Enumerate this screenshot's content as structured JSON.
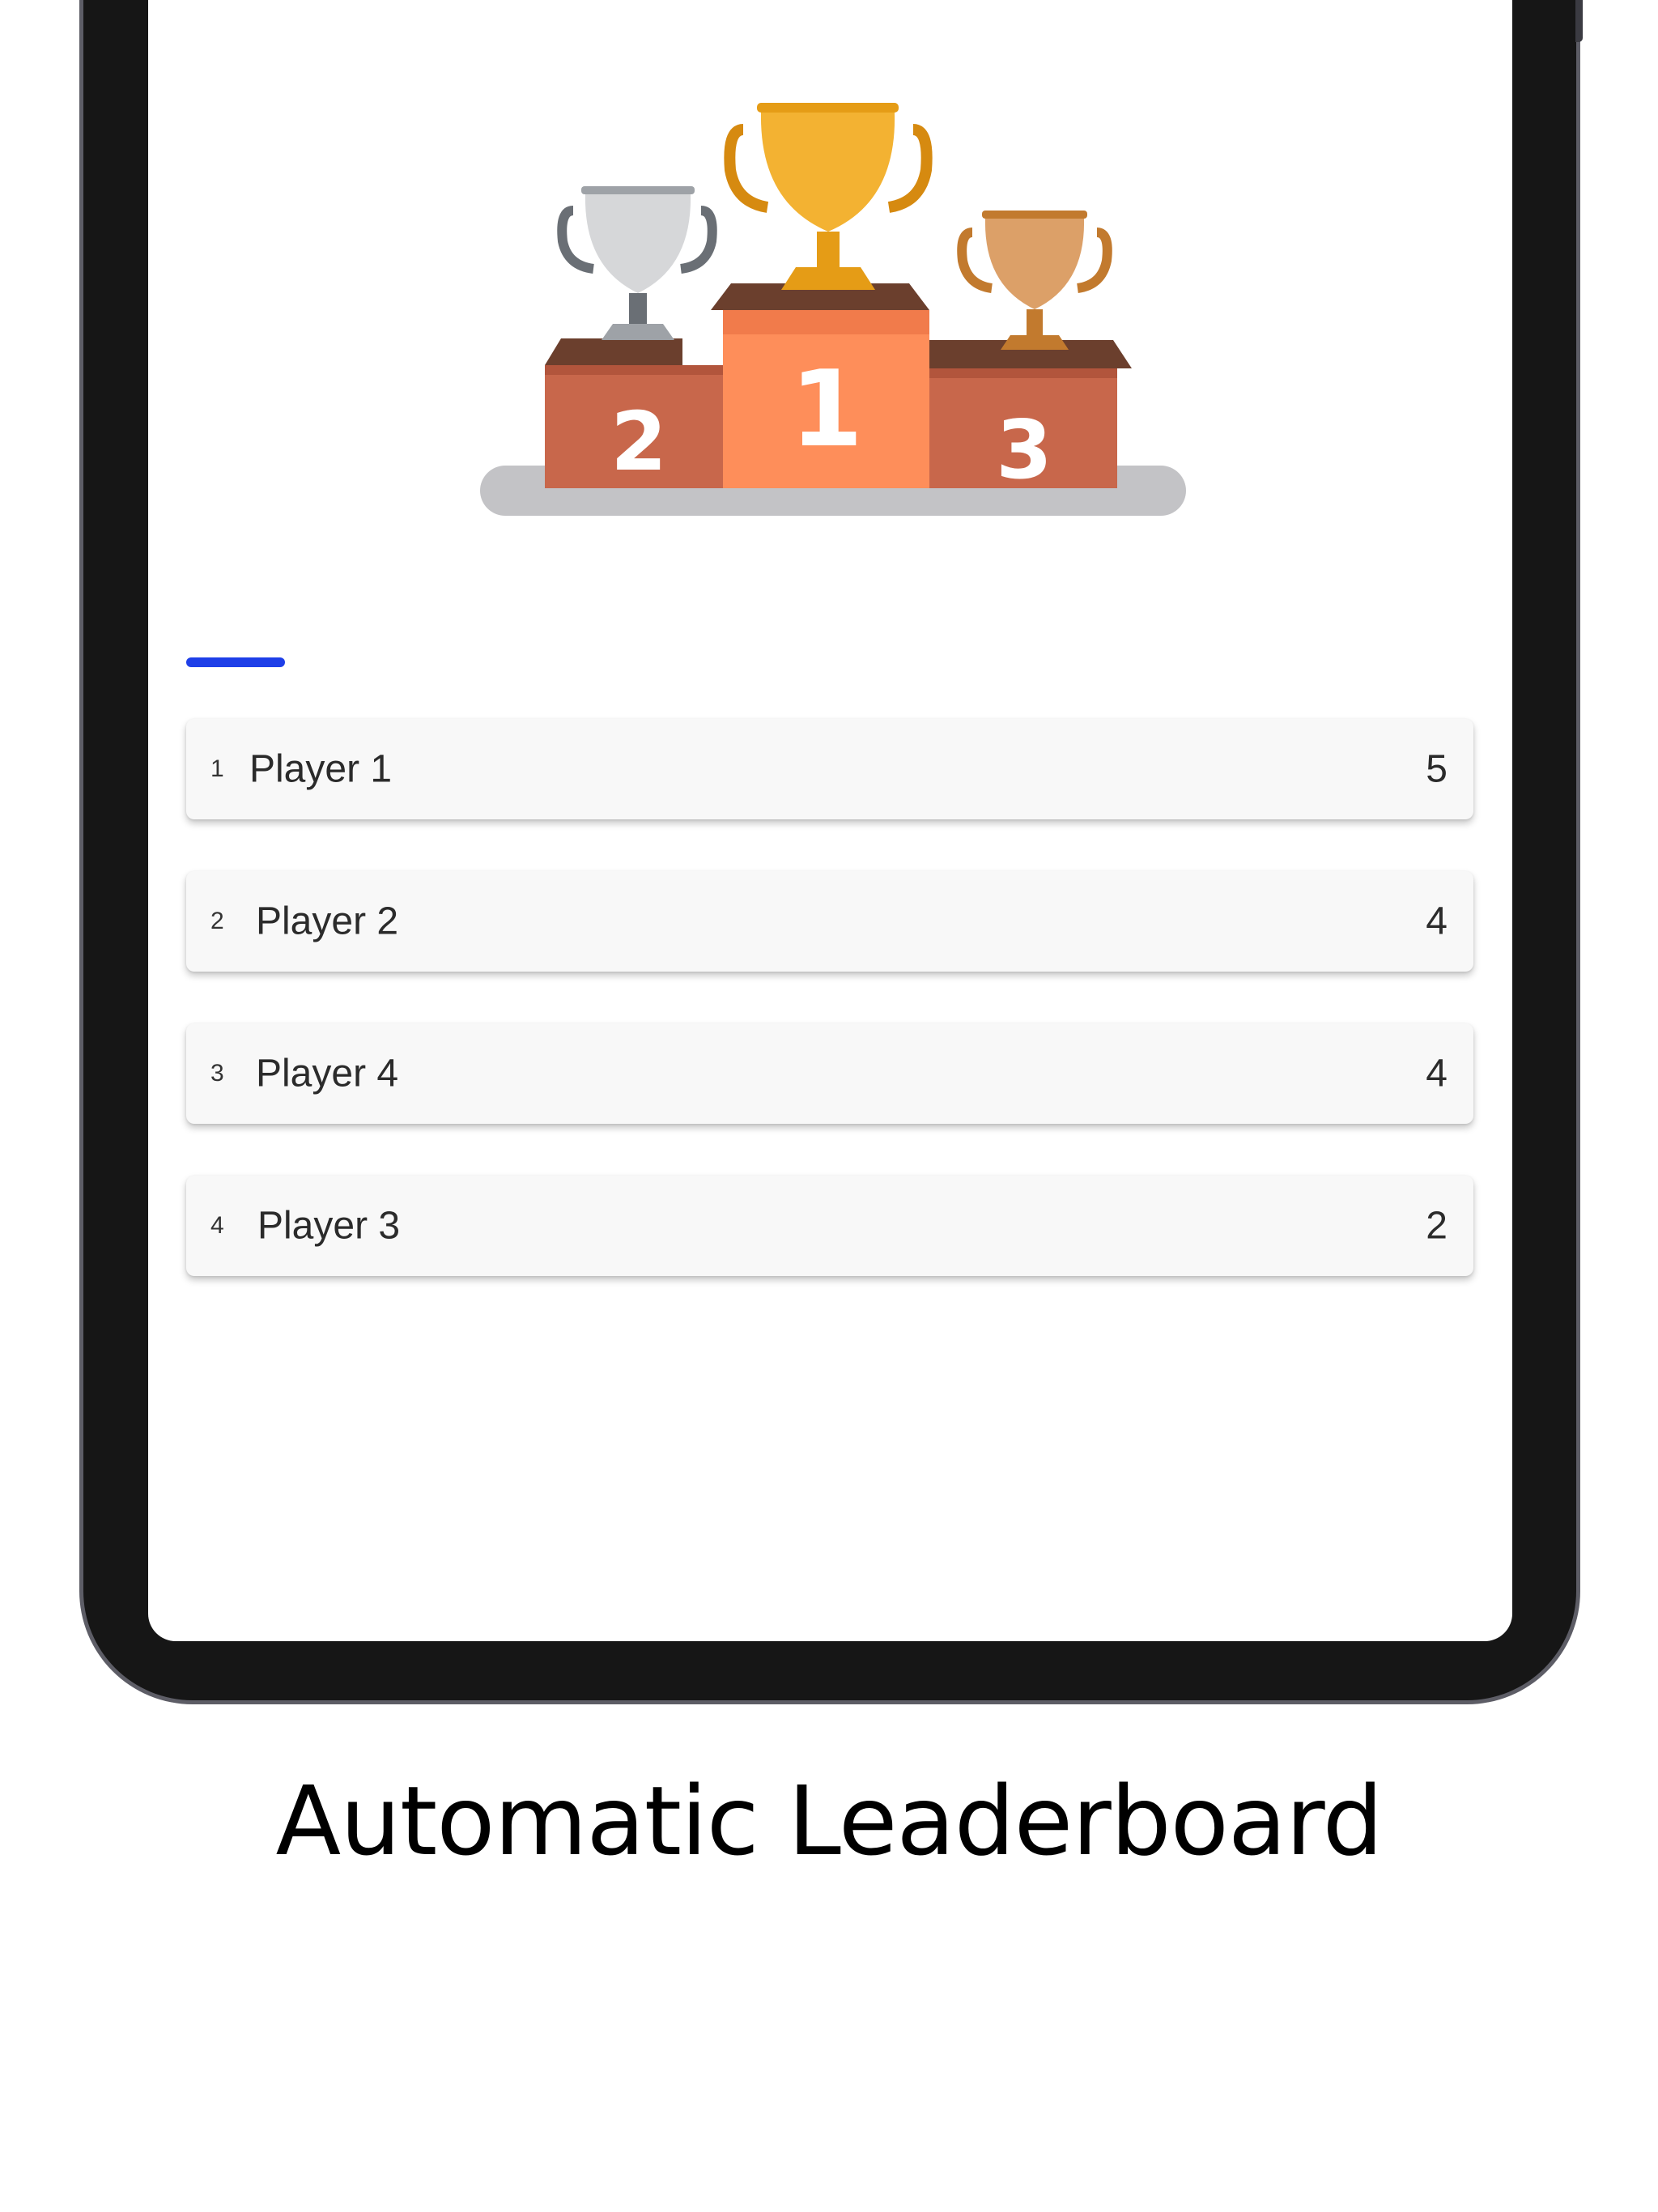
{
  "podium": {
    "first_label": "1",
    "second_label": "2",
    "third_label": "3"
  },
  "leaderboard": {
    "rows": [
      {
        "rank": "1",
        "name": "Player 1",
        "score": "5"
      },
      {
        "rank": "2",
        "name": "Player 2",
        "score": "4"
      },
      {
        "rank": "3",
        "name": "Player 4",
        "score": "4"
      },
      {
        "rank": "4",
        "name": "Player 3",
        "score": "2"
      }
    ]
  },
  "caption": "Automatic Leaderboard",
  "colors": {
    "accent": "#1e3fe8",
    "gold": "#f3b232",
    "silver": "#d6d7d9",
    "bronze": "#dca068",
    "podium_center": "#fe8e5a",
    "podium_side": "#c8674b"
  }
}
